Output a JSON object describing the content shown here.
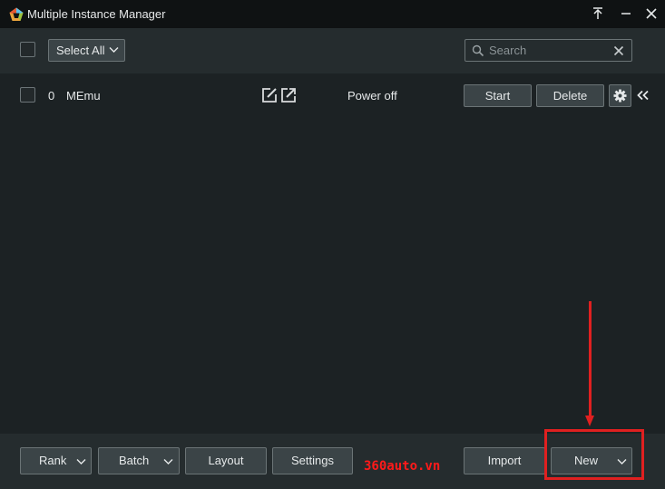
{
  "window": {
    "title": "Multiple Instance Manager"
  },
  "toolbar": {
    "select_all_label": "Select All",
    "search_placeholder": "Search"
  },
  "instances": [
    {
      "index": "0",
      "name": "MEmu",
      "status": "Power off",
      "start_label": "Start",
      "delete_label": "Delete"
    }
  ],
  "footer": {
    "rank_label": "Rank",
    "batch_label": "Batch",
    "layout_label": "Layout",
    "settings_label": "Settings",
    "watermark": "360auto.vn",
    "import_label": "Import",
    "new_label": "New"
  },
  "colors": {
    "background": "#1c2224",
    "panel": "#252c2e",
    "titlebar": "#0f1213",
    "button": "#3b4447",
    "annotation": "#e02020"
  },
  "icons": [
    "app-logo-icon",
    "upload-icon",
    "close-icon",
    "chevron-down-icon",
    "search-icon",
    "clear-icon",
    "edit-icon",
    "open-external-icon",
    "gear-icon",
    "double-chevron-left-icon"
  ]
}
